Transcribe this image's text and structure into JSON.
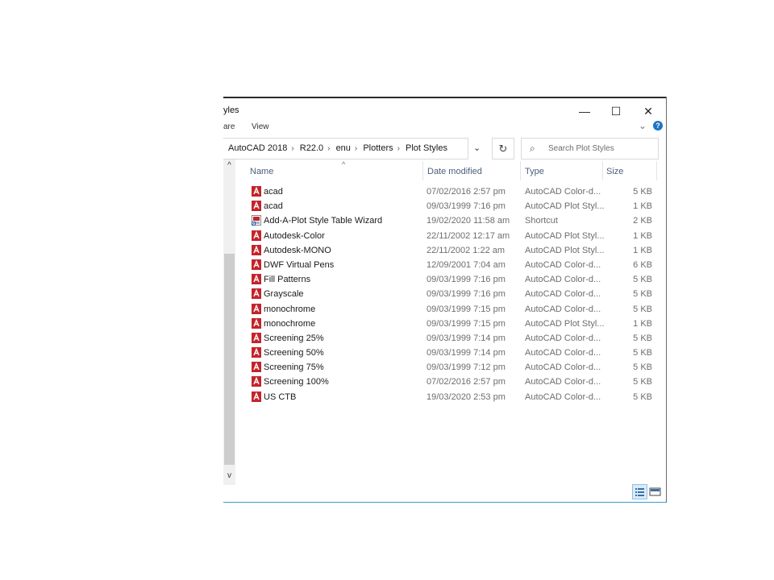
{
  "window": {
    "title": "yles",
    "minimize": "—",
    "maximize": "☐",
    "close": "✕"
  },
  "ribbon": {
    "share": "are",
    "view": "View",
    "expand": "⌄",
    "help": "?"
  },
  "address": {
    "crumbs": [
      "AutoCAD 2018",
      "R22.0",
      "enu",
      "Plotters",
      "Plot Styles"
    ],
    "separator": "›",
    "dropdown": "⌄",
    "refresh": "↻"
  },
  "search": {
    "icon": "⌕",
    "placeholder": "Search Plot Styles"
  },
  "columns": {
    "name": "Name",
    "date": "Date modified",
    "type": "Type",
    "size": "Size",
    "sort": "^"
  },
  "navpane": {
    "up": "^",
    "down": "v"
  },
  "files": [
    {
      "name": "acad",
      "date": "07/02/2016 2:57 pm",
      "type": "AutoCAD Color-d...",
      "size": "5 KB",
      "icon": "autocad-file-icon"
    },
    {
      "name": "acad",
      "date": "09/03/1999 7:16 pm",
      "type": "AutoCAD Plot Styl...",
      "size": "1 KB",
      "icon": "autocad-file-icon"
    },
    {
      "name": "Add-A-Plot Style Table Wizard",
      "date": "19/02/2020 11:58 am",
      "type": "Shortcut",
      "size": "2 KB",
      "icon": "shortcut-icon"
    },
    {
      "name": "Autodesk-Color",
      "date": "22/11/2002 12:17 am",
      "type": "AutoCAD Plot Styl...",
      "size": "1 KB",
      "icon": "autocad-file-icon"
    },
    {
      "name": "Autodesk-MONO",
      "date": "22/11/2002 1:22 am",
      "type": "AutoCAD Plot Styl...",
      "size": "1 KB",
      "icon": "autocad-file-icon"
    },
    {
      "name": "DWF Virtual Pens",
      "date": "12/09/2001 7:04 am",
      "type": "AutoCAD Color-d...",
      "size": "6 KB",
      "icon": "autocad-file-icon"
    },
    {
      "name": "Fill Patterns",
      "date": "09/03/1999 7:16 pm",
      "type": "AutoCAD Color-d...",
      "size": "5 KB",
      "icon": "autocad-file-icon"
    },
    {
      "name": "Grayscale",
      "date": "09/03/1999 7:16 pm",
      "type": "AutoCAD Color-d...",
      "size": "5 KB",
      "icon": "autocad-file-icon"
    },
    {
      "name": "monochrome",
      "date": "09/03/1999 7:15 pm",
      "type": "AutoCAD Color-d...",
      "size": "5 KB",
      "icon": "autocad-file-icon"
    },
    {
      "name": "monochrome",
      "date": "09/03/1999 7:15 pm",
      "type": "AutoCAD Plot Styl...",
      "size": "1 KB",
      "icon": "autocad-file-icon"
    },
    {
      "name": "Screening 25%",
      "date": "09/03/1999 7:14 pm",
      "type": "AutoCAD Color-d...",
      "size": "5 KB",
      "icon": "autocad-file-icon"
    },
    {
      "name": "Screening 50%",
      "date": "09/03/1999 7:14 pm",
      "type": "AutoCAD Color-d...",
      "size": "5 KB",
      "icon": "autocad-file-icon"
    },
    {
      "name": "Screening 75%",
      "date": "09/03/1999 7:12 pm",
      "type": "AutoCAD Color-d...",
      "size": "5 KB",
      "icon": "autocad-file-icon"
    },
    {
      "name": "Screening 100%",
      "date": "07/02/2016 2:57 pm",
      "type": "AutoCAD Color-d...",
      "size": "5 KB",
      "icon": "autocad-file-icon"
    },
    {
      "name": "US CTB",
      "date": "19/03/2020 2:53 pm",
      "type": "AutoCAD Color-d...",
      "size": "5 KB",
      "icon": "autocad-file-icon"
    }
  ],
  "colors": {
    "accent": "#39a0c9",
    "autocad_red": "#c4232b",
    "header_text": "#4c607a"
  }
}
